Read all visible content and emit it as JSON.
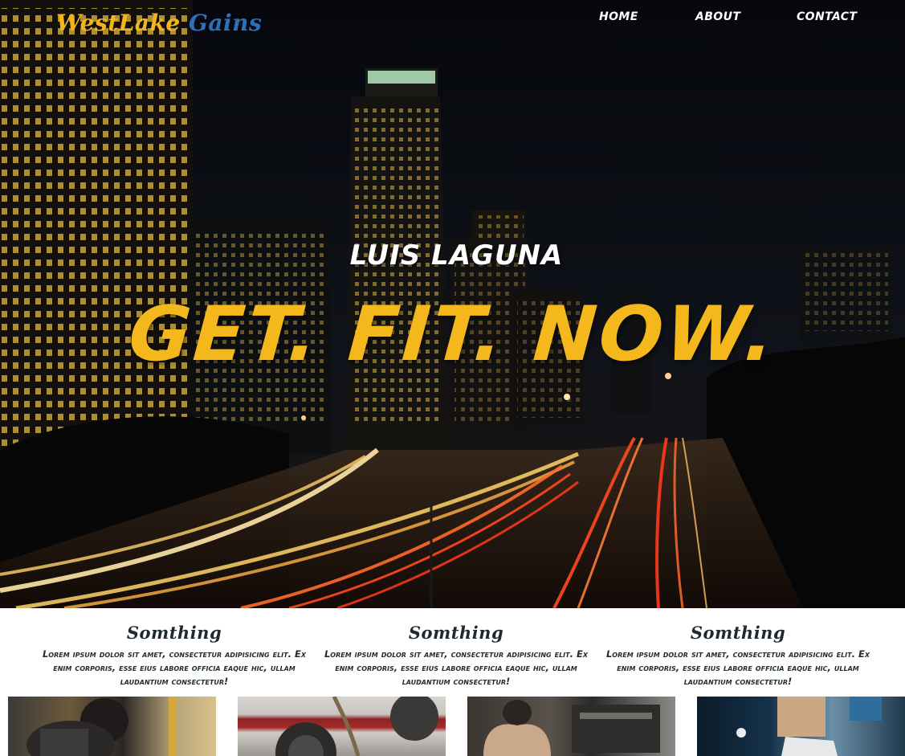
{
  "brand": {
    "part1": "WestLake",
    "part2": "Gains",
    "color1": "#f2b51a",
    "color2": "#2f6fb8"
  },
  "nav": {
    "items": [
      "HOME",
      "ABOUT",
      "CONTACT"
    ]
  },
  "hero": {
    "name": "LUIS LAGUNA",
    "slogan": "GET. FIT. NOW.",
    "slogan_color": "#f4b81c"
  },
  "features": [
    {
      "title": "Somthing",
      "text": "Lorem ipsum dolor sit amet, consectetur adipisicing elit. Ex enim corporis, esse eius labore officia eaque hic, ullam laudantium consectetur!"
    },
    {
      "title": "Somthing",
      "text": "Lorem ipsum dolor sit amet, consectetur adipisicing elit. Ex enim corporis, esse eius labore officia eaque hic, ullam laudantium consectetur!"
    },
    {
      "title": "Somthing",
      "text": "Lorem ipsum dolor sit amet, consectetur adipisicing elit. Ex enim corporis, esse eius labore officia eaque hic, ullam laudantium consectetur!"
    }
  ],
  "gallery": [
    {
      "subject": "man-lifting-photo"
    },
    {
      "subject": "barbell-plates-photo"
    },
    {
      "subject": "man-stretching-photo"
    },
    {
      "subject": "runner-shoes-photo"
    }
  ]
}
